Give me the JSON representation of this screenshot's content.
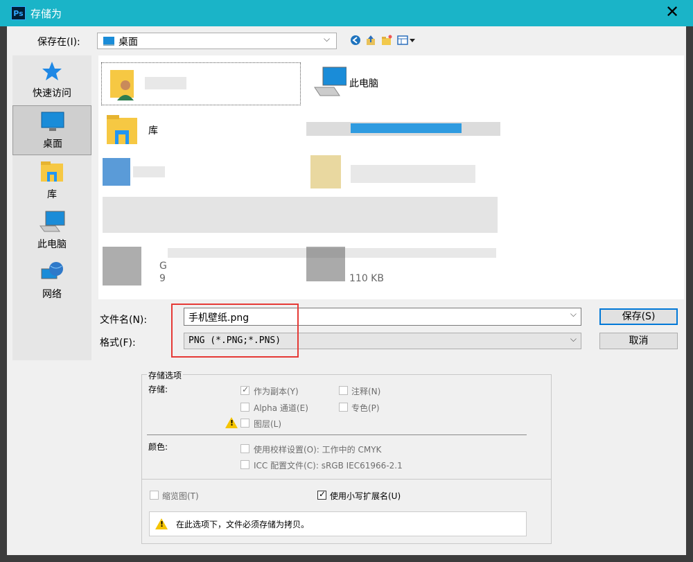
{
  "window": {
    "title": "存储为",
    "app_icon": "Ps"
  },
  "toolbar": {
    "save_in_label": "保存在(I):",
    "location": "桌面"
  },
  "places": [
    {
      "label": "快速访问",
      "icon": "star-icon"
    },
    {
      "label": "桌面",
      "icon": "desktop-icon"
    },
    {
      "label": "库",
      "icon": "library-icon"
    },
    {
      "label": "此电脑",
      "icon": "computer-icon"
    },
    {
      "label": "网络",
      "icon": "network-icon"
    }
  ],
  "files": [
    {
      "label": "此电脑",
      "icon": "computer-icon"
    },
    {
      "label": "库",
      "icon": "library-folder-icon"
    },
    {
      "label": "G",
      "icon": "file-icon"
    },
    {
      "label": "9",
      "icon": "file-icon"
    },
    {
      "label": "110 KB",
      "icon": "file-icon"
    }
  ],
  "form": {
    "filename_label": "文件名(N):",
    "filename_value": "手机壁纸.png",
    "format_label": "格式(F):",
    "format_value": "PNG (*.PNG;*.PNS)",
    "save_button": "保存(S)",
    "cancel_button": "取消"
  },
  "options": {
    "title": "存储选项",
    "store_label": "存储:",
    "as_copy": "作为副本(Y)",
    "notes": "注释(N)",
    "alpha": "Alpha 通道(E)",
    "spot": "专色(P)",
    "layers": "图层(L)",
    "color_label": "颜色:",
    "proof_setup": "使用校样设置(O): 工作中的 CMYK",
    "icc_profile": "ICC 配置文件(C): sRGB IEC61966-2.1",
    "thumbnail": "缩览图(T)",
    "lowercase_ext": "使用小写扩展名(U)",
    "warning": "在此选项下，文件必须存储为拷贝。"
  },
  "colors": {
    "titlebar": "#1ab4c8",
    "highlight": "#e53935",
    "accent": "#0078d7"
  }
}
